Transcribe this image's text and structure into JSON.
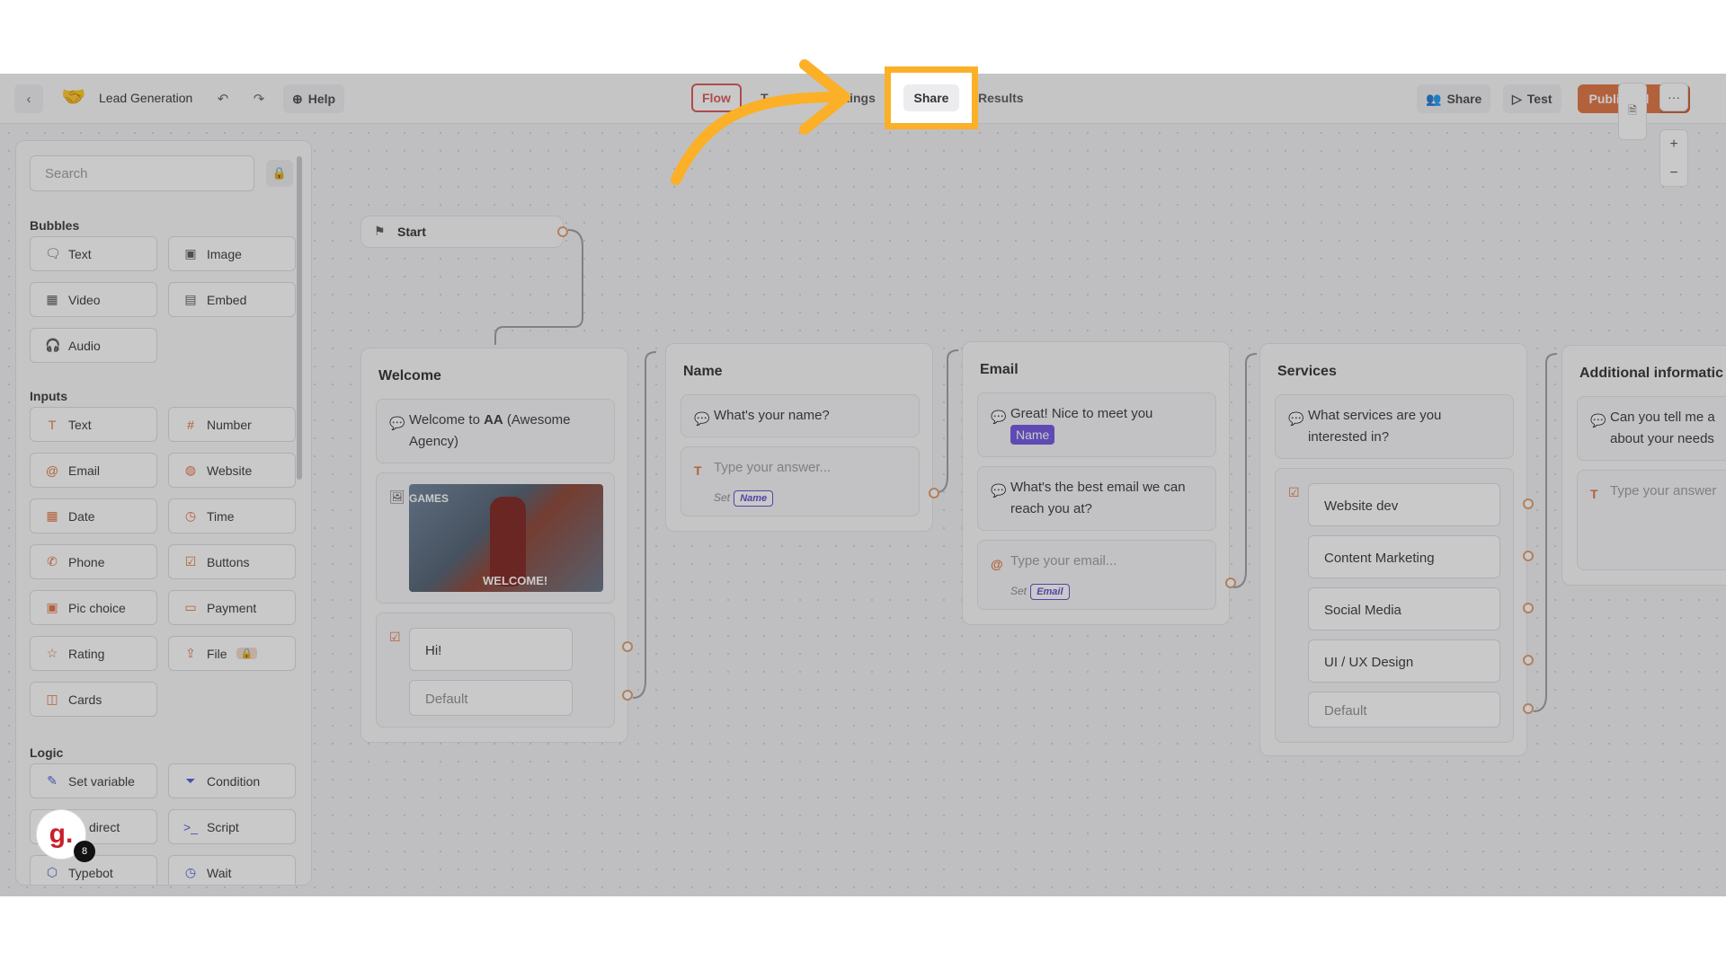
{
  "header": {
    "title": "Lead Generation",
    "help_label": "Help",
    "nav_tabs": [
      {
        "label": "Flow"
      },
      {
        "label": "T"
      },
      {
        "label": "ettings"
      },
      {
        "label": "Share"
      },
      {
        "label": "Results"
      }
    ],
    "share_label": "Share",
    "test_label": "Test",
    "publish_label": "Published"
  },
  "sidebar": {
    "search_placeholder": "Search",
    "sections": [
      {
        "title": "Bubbles",
        "items": [
          {
            "label": "Text"
          },
          {
            "label": "Image"
          },
          {
            "label": "Video"
          },
          {
            "label": "Embed"
          },
          {
            "label": "Audio"
          }
        ]
      },
      {
        "title": "Inputs",
        "items": [
          {
            "label": "Text"
          },
          {
            "label": "Number"
          },
          {
            "label": "Email"
          },
          {
            "label": "Website"
          },
          {
            "label": "Date"
          },
          {
            "label": "Time"
          },
          {
            "label": "Phone"
          },
          {
            "label": "Buttons"
          },
          {
            "label": "Pic choice"
          },
          {
            "label": "Payment"
          },
          {
            "label": "Rating"
          },
          {
            "label": "File"
          },
          {
            "label": "Cards"
          }
        ]
      },
      {
        "title": "Logic",
        "items": [
          {
            "label": "Set variable"
          },
          {
            "label": "Condition"
          },
          {
            "label": "direct"
          },
          {
            "label": "Script"
          },
          {
            "label": "Typebot"
          },
          {
            "label": "Wait"
          }
        ]
      }
    ]
  },
  "canvas": {
    "start": {
      "label": "Start"
    },
    "welcome": {
      "title": "Welcome",
      "text_prefix": "Welcome to ",
      "text_bold": "AA",
      "text_suffix": " (Awesome Agency)",
      "gif_caption": "WELCOME!",
      "gif_top": "GAMES",
      "button": "Hi!",
      "default": "Default"
    },
    "name": {
      "title": "Name",
      "question": "What's your name?",
      "placeholder": "Type your answer...",
      "set": "Set",
      "var": "Name"
    },
    "email": {
      "title": "Email",
      "greeting": "Great! Nice to meet you",
      "var_name": "Name",
      "question": "What's the best email we can reach you at?",
      "placeholder": "Type your email...",
      "set": "Set",
      "var": "Email"
    },
    "services": {
      "title": "Services",
      "question": "What services are you interested in?",
      "options": [
        {
          "label": "Website dev"
        },
        {
          "label": "Content Marketing"
        },
        {
          "label": "Social Media"
        },
        {
          "label": "UI / UX Design"
        }
      ],
      "default": "Default"
    },
    "additional": {
      "title": "Additional informatic",
      "question": "Can you tell me a about your needs",
      "placeholder": "Type your answer"
    }
  },
  "chat_badge": {
    "letter": "g.",
    "count": "8"
  },
  "colors": {
    "highlight": "#fbb028",
    "accent": "#e0703a",
    "variable": "#6d4fe0"
  }
}
